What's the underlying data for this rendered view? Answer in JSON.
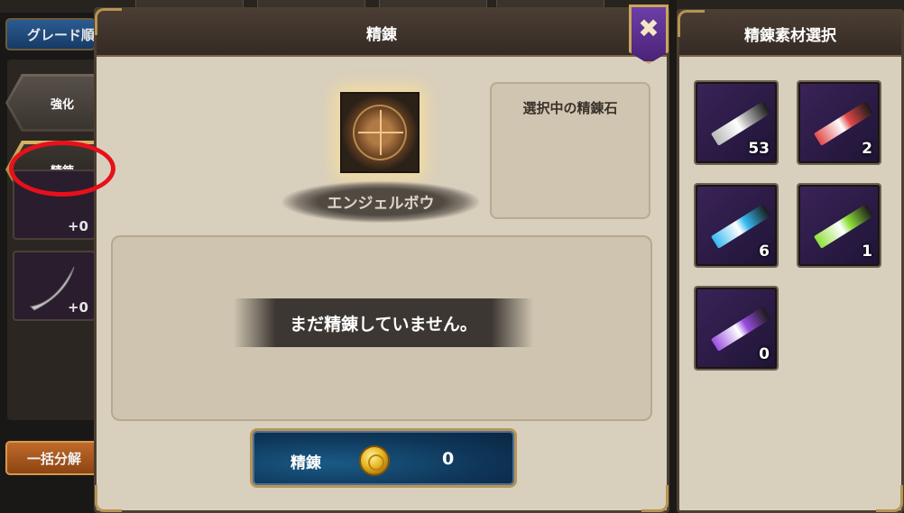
{
  "left": {
    "grade_label": "グレード順",
    "tabs": [
      {
        "label": "強化"
      },
      {
        "label": "精錬"
      }
    ],
    "items": [
      {
        "level": "+0"
      },
      {
        "level": "+0"
      }
    ],
    "bulk_button": "一括分解"
  },
  "refine_panel": {
    "title": "精錬",
    "weapon_name": "エンジェルボウ",
    "selected_stone_title": "選択中の精錬石",
    "result_message": "まだ精錬していません。",
    "refine_button_label": "精錬",
    "refine_cost": "0",
    "close_icon": "✖"
  },
  "material_panel": {
    "title": "精錬素材選択",
    "materials": [
      {
        "name": "gray-refine-stone",
        "count": "53",
        "color": "#b8b8b8"
      },
      {
        "name": "red-refine-stone",
        "count": "2",
        "color": "#e04848"
      },
      {
        "name": "blue-refine-stone",
        "count": "6",
        "color": "#36b8f0"
      },
      {
        "name": "green-refine-stone",
        "count": "1",
        "color": "#8ee03a"
      },
      {
        "name": "purple-refine-stone",
        "count": "0",
        "color": "#9a4ee0"
      }
    ]
  }
}
